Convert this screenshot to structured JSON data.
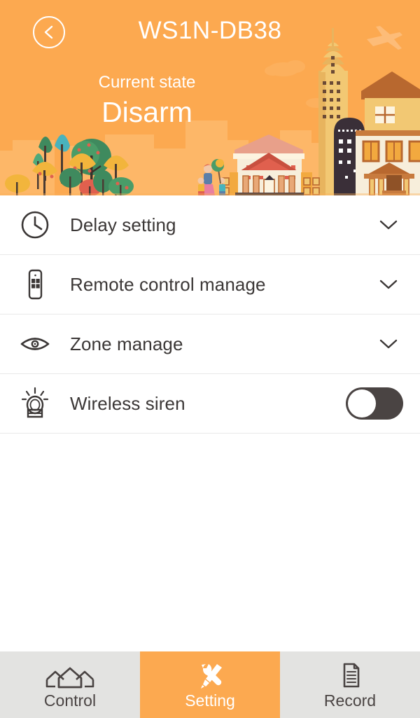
{
  "header": {
    "title": "WS1N-DB38",
    "state_label": "Current state",
    "state_value": "Disarm",
    "back_icon": "chevron-left-icon",
    "background_color": "#fca950",
    "text_color": "#ffffff",
    "illustration": "city-skyline-buildings-trees"
  },
  "settings_list": {
    "rows": [
      {
        "label": "Delay setting",
        "icon": "clock-icon",
        "accessory": "chevron-down-icon"
      },
      {
        "label": "Remote control manage",
        "icon": "remote-control-icon",
        "accessory": "chevron-down-icon"
      },
      {
        "label": "Zone manage",
        "icon": "eye-icon",
        "accessory": "chevron-down-icon"
      },
      {
        "label": "Wireless siren",
        "icon": "siren-icon",
        "accessory": "toggle-switch",
        "toggle_state": "off"
      }
    ],
    "divider_color": "#e9e9e9",
    "label_color": "#3b3736",
    "toggle_off_color": "#4a4443"
  },
  "tabbar": {
    "background_color": "#e3e3e1",
    "active_color": "#fca950",
    "tabs": [
      {
        "label": "Control",
        "icon": "houses-icon",
        "active": false
      },
      {
        "label": "Setting",
        "icon": "tools-icon",
        "active": true
      },
      {
        "label": "Record",
        "icon": "document-icon",
        "active": false
      }
    ]
  }
}
